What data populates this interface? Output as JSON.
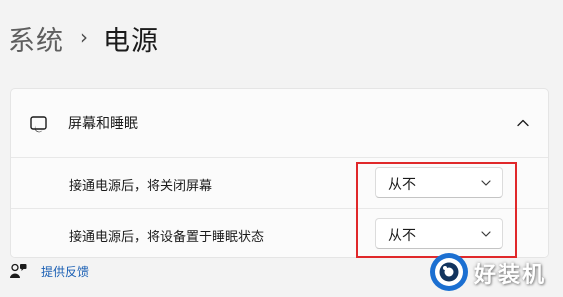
{
  "breadcrumb": {
    "parent": "系统",
    "separator": "›",
    "current": "电源"
  },
  "section": {
    "title": "屏幕和睡眠",
    "icon": "screen-sleep-icon",
    "expanded": true
  },
  "settings": [
    {
      "label": "接通电源后，将关闭屏幕",
      "value": "从不"
    },
    {
      "label": "接通电源后，将设备置于睡眠状态",
      "value": "从不"
    }
  ],
  "feedback": {
    "label": "提供反馈",
    "icon": "feedback-person-icon"
  },
  "watermark": {
    "text": "好装机"
  },
  "colors": {
    "highlight": "#e0282a",
    "link": "#1a5fb4",
    "background": "#f3f3f3"
  }
}
